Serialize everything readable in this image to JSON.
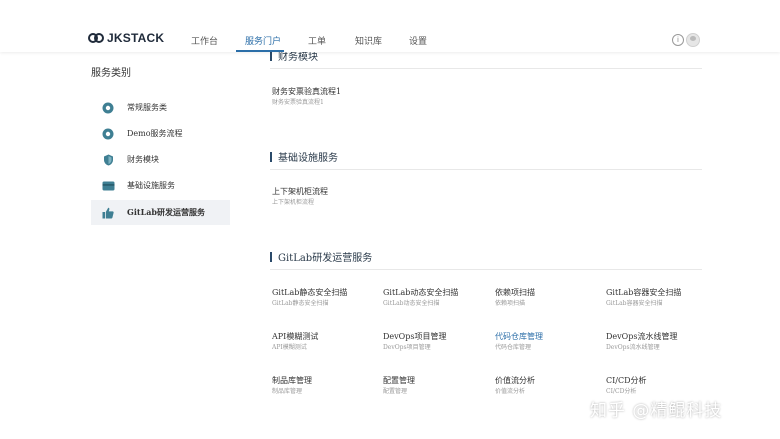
{
  "brand": {
    "logo_text": "JKSTACK"
  },
  "nav": {
    "items": [
      {
        "label": "工作台"
      },
      {
        "label": "服务门户"
      },
      {
        "label": "工单"
      },
      {
        "label": "知识库"
      },
      {
        "label": "设置"
      }
    ],
    "active_index": 1
  },
  "header": {
    "info_icon": "i"
  },
  "sidebar": {
    "title": "服务类别",
    "items": [
      {
        "label": "常规服务类",
        "icon": "circle-badge-icon"
      },
      {
        "label": "Demo服务流程",
        "icon": "circle-badge-icon"
      },
      {
        "label": "财务模块",
        "icon": "shield-icon"
      },
      {
        "label": "基础设施服务",
        "icon": "card-icon"
      },
      {
        "label": "GitLab研发运营服务",
        "icon": "thumbs-up-icon"
      }
    ],
    "active_index": 4
  },
  "sections": [
    {
      "title": "财务模块",
      "cards": [
        {
          "title": "财务安票验真流程1",
          "sub": "财务安票验真流程1"
        }
      ]
    },
    {
      "title": "基础设施服务",
      "cards": [
        {
          "title": "上下架机柜流程",
          "sub": "上下架机柜流程"
        }
      ]
    },
    {
      "title": "GitLab研发运营服务",
      "cards": [
        {
          "title": "GitLab静态安全扫描",
          "sub": "GitLab静态安全扫描"
        },
        {
          "title": "GitLab动态安全扫描",
          "sub": "GitLab动态安全扫描"
        },
        {
          "title": "依赖项扫描",
          "sub": "依赖项扫描"
        },
        {
          "title": "GitLab容器安全扫描",
          "sub": "GitLab容器安全扫描"
        },
        {
          "title": "API模糊测试",
          "sub": "API模糊测试"
        },
        {
          "title": "DevOps项目管理",
          "sub": "DevOps项目管理"
        },
        {
          "title": "代码仓库管理",
          "sub": "代码仓库管理"
        },
        {
          "title": "DevOps流水线管理",
          "sub": "DevOps流水线管理"
        },
        {
          "title": "制品库管理",
          "sub": "制品库管理"
        },
        {
          "title": "配置管理",
          "sub": "配置管理"
        },
        {
          "title": "价值流分析",
          "sub": "价值流分析"
        },
        {
          "title": "CI/CD分析",
          "sub": "CI/CD分析"
        }
      ]
    }
  ],
  "colors": {
    "accent": "#2b6ea8",
    "icon_teal": "#3f7f93",
    "active_bg": "#f0f2f5"
  },
  "watermark": "知乎 @精鲲科技"
}
